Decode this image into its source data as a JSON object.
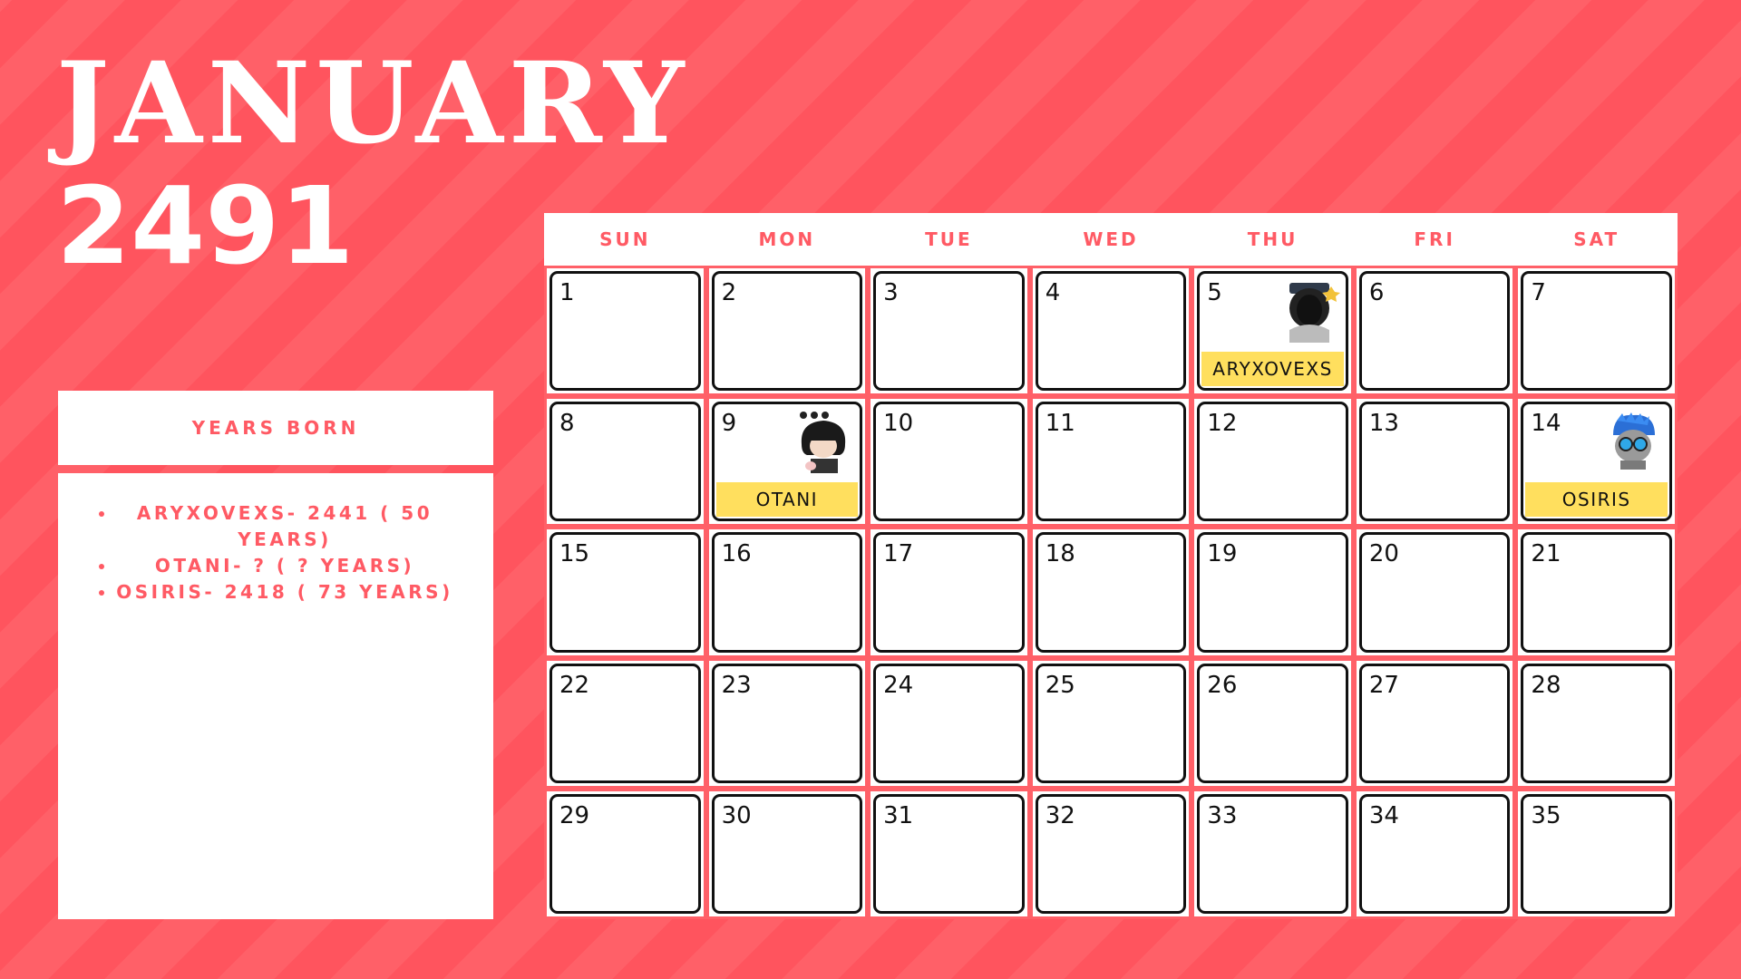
{
  "title": {
    "month": "JANUARY",
    "year": "2491"
  },
  "sidebar": {
    "header": "YEARS BORN",
    "items": [
      "ARYXOVEXS- 2441 ( 50 YEARS)",
      "OTANI- ? ( ? YEARS)",
      "OSIRIS- 2418 ( 73 YEARS)"
    ]
  },
  "calendar": {
    "weekdays": [
      "SUN",
      "MON",
      "TUE",
      "WED",
      "THU",
      "FRI",
      "SAT"
    ],
    "days": [
      "1",
      "2",
      "3",
      "4",
      "5",
      "6",
      "7",
      "8",
      "9",
      "10",
      "11",
      "12",
      "13",
      "14",
      "15",
      "16",
      "17",
      "18",
      "19",
      "20",
      "21",
      "22",
      "23",
      "24",
      "25",
      "26",
      "27",
      "28",
      "29",
      "30",
      "31",
      "32",
      "33",
      "34",
      "35"
    ],
    "events": {
      "day5": "ARYXOVEXS",
      "day9": "OTANI",
      "day14": "OSIRIS"
    }
  },
  "colors": {
    "background": "#ff6068",
    "accent": "#ff5a64",
    "tag": "#ffdf5e"
  },
  "icons": {
    "day5": "masked-character-avatar-icon",
    "day9": "dark-hair-character-avatar-icon",
    "day14": "blue-hair-goggles-avatar-icon"
  }
}
